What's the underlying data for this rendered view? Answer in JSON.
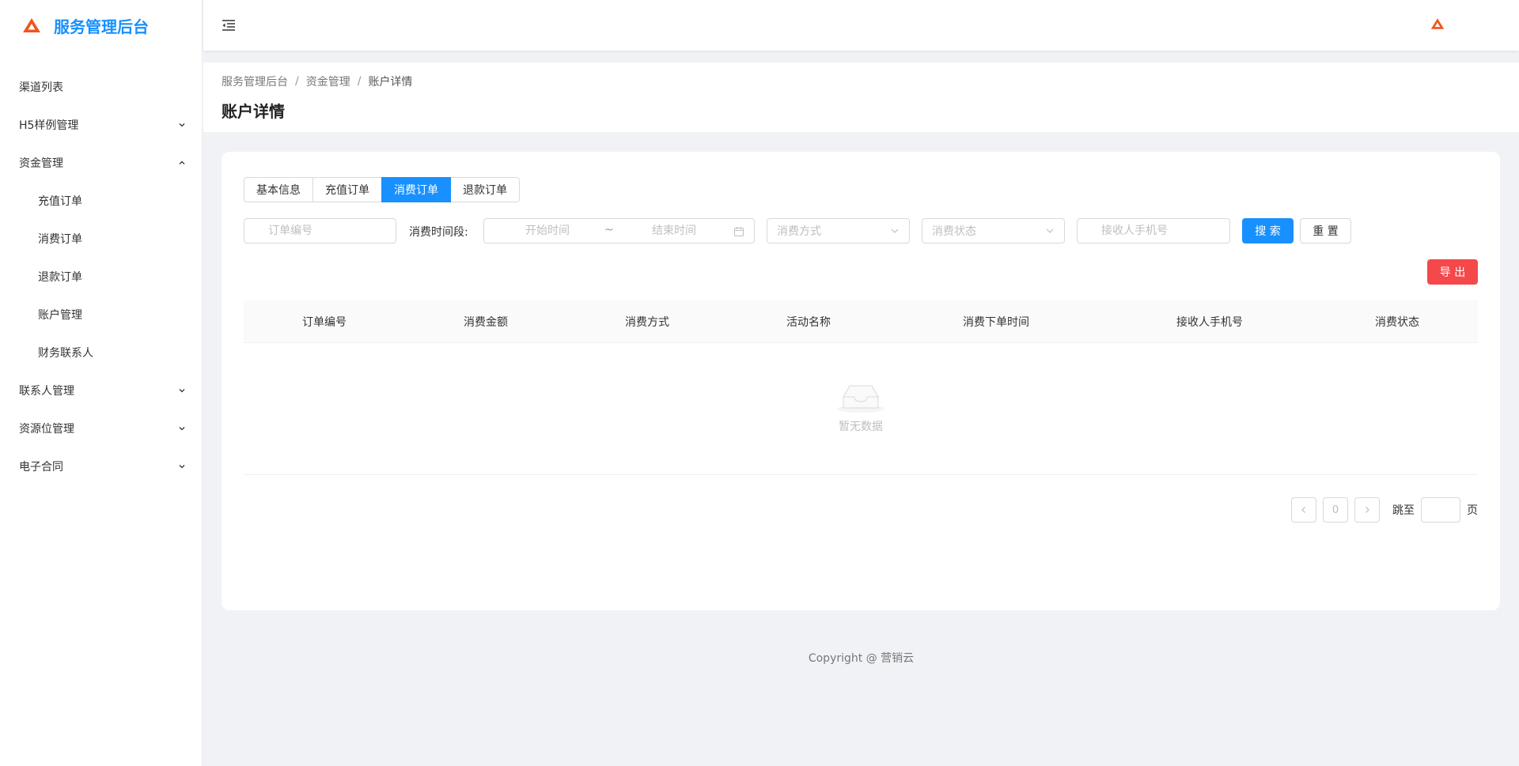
{
  "app": {
    "title": "服务管理后台"
  },
  "sidebar": {
    "items": [
      {
        "label": "渠道列表",
        "chevron": "none"
      },
      {
        "label": "H5样例管理",
        "chevron": "down"
      },
      {
        "label": "资金管理",
        "chevron": "up"
      },
      {
        "label": "充值订单",
        "sub": true
      },
      {
        "label": "消费订单",
        "sub": true
      },
      {
        "label": "退款订单",
        "sub": true
      },
      {
        "label": "账户管理",
        "sub": true
      },
      {
        "label": "财务联系人",
        "sub": true
      },
      {
        "label": "联系人管理",
        "chevron": "down"
      },
      {
        "label": "资源位管理",
        "chevron": "down"
      },
      {
        "label": "电子合同",
        "chevron": "down"
      }
    ]
  },
  "breadcrumb": {
    "items": [
      "服务管理后台",
      "资金管理",
      "账户详情"
    ],
    "separator": "/"
  },
  "page": {
    "title": "账户详情"
  },
  "tabs": [
    {
      "label": "基本信息",
      "active": false
    },
    {
      "label": "充值订单",
      "active": false
    },
    {
      "label": "消费订单",
      "active": true
    },
    {
      "label": "退款订单",
      "active": false
    }
  ],
  "filters": {
    "order_no_placeholder": "订单编号",
    "time_range_label": "消费时间段:",
    "start_placeholder": "开始时间",
    "range_separator": "~",
    "end_placeholder": "结束时间",
    "method_placeholder": "消费方式",
    "status_placeholder": "消费状态",
    "phone_placeholder": "接收人手机号",
    "search_label": "搜 索",
    "reset_label": "重 置"
  },
  "export_label": "导 出",
  "table": {
    "columns": [
      "订单编号",
      "消费金额",
      "消费方式",
      "活动名称",
      "消费下单时间",
      "接收人手机号",
      "消费状态"
    ],
    "empty_text": "暂无数据"
  },
  "pagination": {
    "current": "0",
    "jump_label": "跳至",
    "unit": "页"
  },
  "footer": {
    "text": "Copyright @ 营销云"
  },
  "colors": {
    "primary": "#1890ff",
    "danger": "#f5484a",
    "logo": "#f0561d"
  },
  "icons": [
    "logo-icon",
    "menu-fold-icon",
    "chevron-down-icon",
    "chevron-up-icon",
    "calendar-icon",
    "inbox-empty-icon",
    "left-arrow-icon",
    "right-arrow-icon"
  ]
}
